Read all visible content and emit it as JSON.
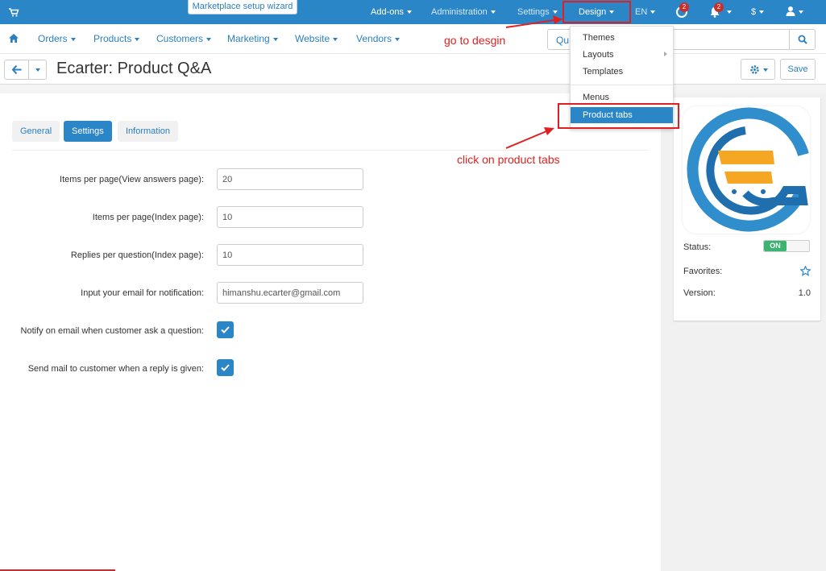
{
  "topbar": {
    "wizard_label": "Marketplace setup wizard",
    "items": [
      {
        "label": "Add-ons"
      },
      {
        "label": "Administration"
      },
      {
        "label": "Settings"
      },
      {
        "label": "Design"
      },
      {
        "label": "EN"
      }
    ],
    "help_badge": "2",
    "notifications_badge": "2",
    "currency": "$",
    "icons": [
      "cart-icon",
      "help-icon",
      "bell-icon",
      "user-icon"
    ]
  },
  "mainnav": {
    "items": [
      {
        "label": "Orders"
      },
      {
        "label": "Products"
      },
      {
        "label": "Customers"
      },
      {
        "label": "Marketing"
      },
      {
        "label": "Website"
      },
      {
        "label": "Vendors"
      }
    ],
    "search_text": "Qu"
  },
  "header": {
    "title": "Ecarter: Product Q&A",
    "save_label": "Save"
  },
  "tabs": [
    {
      "label": "General",
      "active": false
    },
    {
      "label": "Settings",
      "active": true
    },
    {
      "label": "Information",
      "active": false
    }
  ],
  "form": {
    "fields": [
      {
        "label": "Items per page(View answers page):",
        "value": "20"
      },
      {
        "label": "Items per page(Index page):",
        "value": "10"
      },
      {
        "label": "Replies per question(Index page):",
        "value": "10"
      },
      {
        "label": "Input your email for notification:",
        "value": "himanshu.ecarter@gmail.com"
      }
    ],
    "checkboxes": [
      {
        "label": "Notify on email when customer ask a question:",
        "checked": true
      },
      {
        "label": "Send mail to customer when a reply is given:",
        "checked": true
      }
    ]
  },
  "addon_card": {
    "status_label": "Status:",
    "status_value": "ON",
    "favorites_label": "Favorites:",
    "version_label": "Version:",
    "version_value": "1.0"
  },
  "design_menu": {
    "items": [
      {
        "label": "Themes"
      },
      {
        "label": "Layouts"
      },
      {
        "label": "Templates"
      },
      {
        "label": "Menus"
      },
      {
        "label": "Product tabs"
      }
    ]
  },
  "annotations": {
    "step1": "go to desgin",
    "step2": "click on product tabs",
    "color": "#e02020"
  },
  "colors": {
    "primary": "#2a86c7",
    "link": "#2a7fc0",
    "status_on": "#3cb371",
    "badge": "#c9302c"
  }
}
